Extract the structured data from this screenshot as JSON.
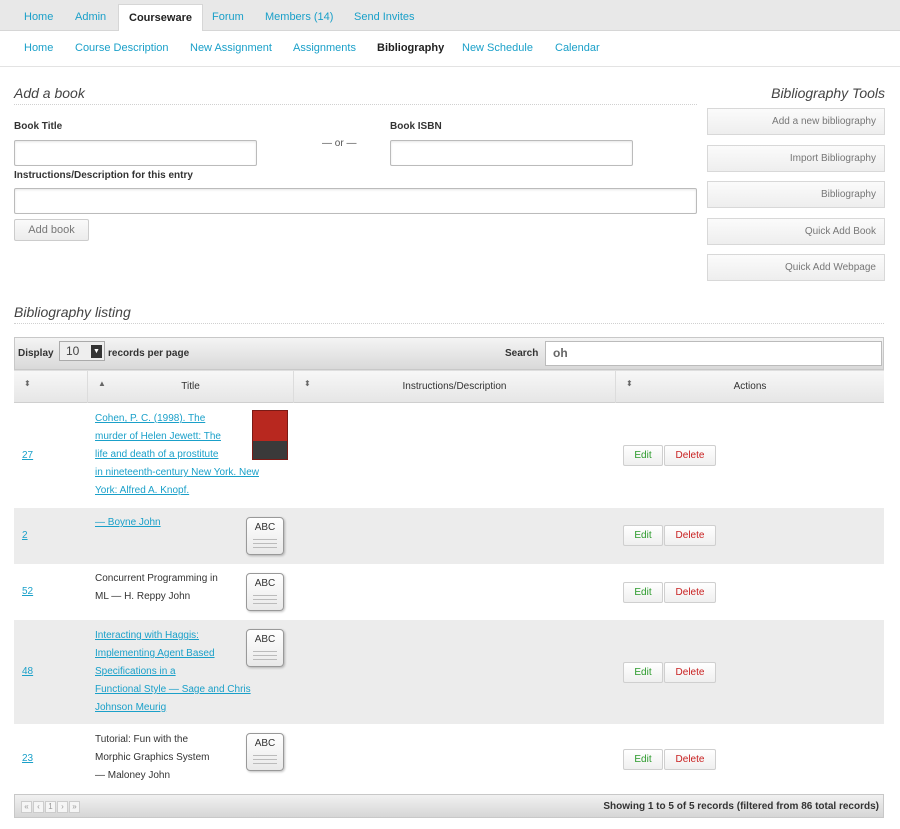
{
  "top_tabs": [
    "Home",
    "Admin",
    "Courseware",
    "Forum",
    "Members (14)",
    "Send Invites"
  ],
  "sub_nav": [
    "Home",
    "Course Description",
    "New Assignment",
    "Assignments",
    "Bibliography",
    "New Schedule",
    "Calendar"
  ],
  "add_book": {
    "title": "Add a book",
    "book_title_label": "Book Title",
    "or_text": "— or —",
    "isbn_label": "Book ISBN",
    "instructions_label": "Instructions/Description for this entry",
    "add_button": "Add book"
  },
  "tools": {
    "title": "Bibliography Tools",
    "buttons": [
      "Add a new bibliography",
      "Import Bibliography",
      "Bibliography",
      "Quick Add Book",
      "Quick Add Webpage"
    ]
  },
  "listing": {
    "title": "Bibliography listing",
    "display_label": "Display",
    "per_page_value": "10",
    "per_page_suffix": "records per page",
    "search_label": "Search",
    "search_value": "oh",
    "columns": [
      "",
      "Title",
      "Instructions/Description",
      "Actions"
    ],
    "rows": [
      {
        "id": "27",
        "title_lines": [
          "Cohen, P. C. (1998). The",
          "murder of Helen Jewett: The",
          "life and death of a prostitute",
          "in nineteenth-century New York. New",
          "York: Alfred A. Knopf."
        ],
        "link": true,
        "thumb": "book-cover"
      },
      {
        "id": "2",
        "title_lines": [
          "— Boyne John"
        ],
        "link": true,
        "thumb": "abc-icon"
      },
      {
        "id": "52",
        "title_lines": [
          "Concurrent Programming in",
          "ML — H. Reppy John"
        ],
        "link": false,
        "thumb": "abc-icon"
      },
      {
        "id": "48",
        "title_lines": [
          "Interacting with Haggis:",
          "Implementing Agent Based",
          "Specifications in a",
          "Functional Style — Sage and Chris",
          "Johnson Meurig"
        ],
        "link": true,
        "thumb": "abc-icon"
      },
      {
        "id": "23",
        "title_lines": [
          "Tutorial: Fun with the",
          "Morphic Graphics System",
          "— Maloney John"
        ],
        "link": false,
        "thumb": "abc-icon"
      }
    ],
    "edit_label": "Edit",
    "delete_label": "Delete",
    "abc_text": "ABC",
    "pager": [
      "«",
      "‹",
      "1",
      "›",
      "»"
    ],
    "footer_info": "Showing 1 to 5 of 5 records (filtered from 86 total records)"
  }
}
